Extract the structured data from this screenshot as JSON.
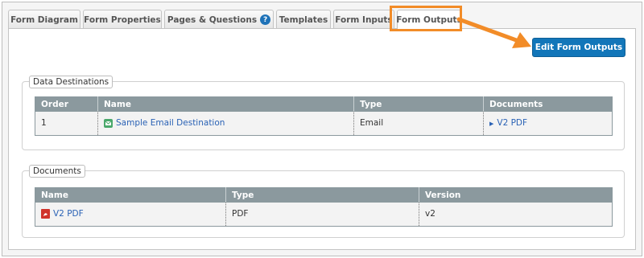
{
  "tabs": [
    {
      "label": "Form Diagram",
      "active": false
    },
    {
      "label": "Form Properties",
      "active": false
    },
    {
      "label": "Pages & Questions",
      "active": false,
      "badge": "?"
    },
    {
      "label": "Templates",
      "active": false
    },
    {
      "label": "Form Inputs",
      "active": false
    },
    {
      "label": "Form Outputs",
      "active": true
    }
  ],
  "edit_button_label": "Edit Form Outputs",
  "annotation": {
    "highlight_color": "#f28c28"
  },
  "colors": {
    "accent": "#1276b9",
    "header": "#8b999e",
    "link": "#2a62b5",
    "pdf": "#d0332b",
    "email": "#4aa86b"
  },
  "data_destinations": {
    "legend": "Data Destinations",
    "columns": [
      "Order",
      "Name",
      "Type",
      "Documents"
    ],
    "rows": [
      {
        "order": "1",
        "name": "Sample Email Destination",
        "name_icon": "email-icon",
        "type": "Email",
        "documents": "V2 PDF"
      }
    ]
  },
  "documents": {
    "legend": "Documents",
    "columns": [
      "Name",
      "Type",
      "Version"
    ],
    "rows": [
      {
        "name": "V2 PDF",
        "name_icon": "pdf-icon",
        "type": "PDF",
        "version": "v2"
      }
    ]
  }
}
